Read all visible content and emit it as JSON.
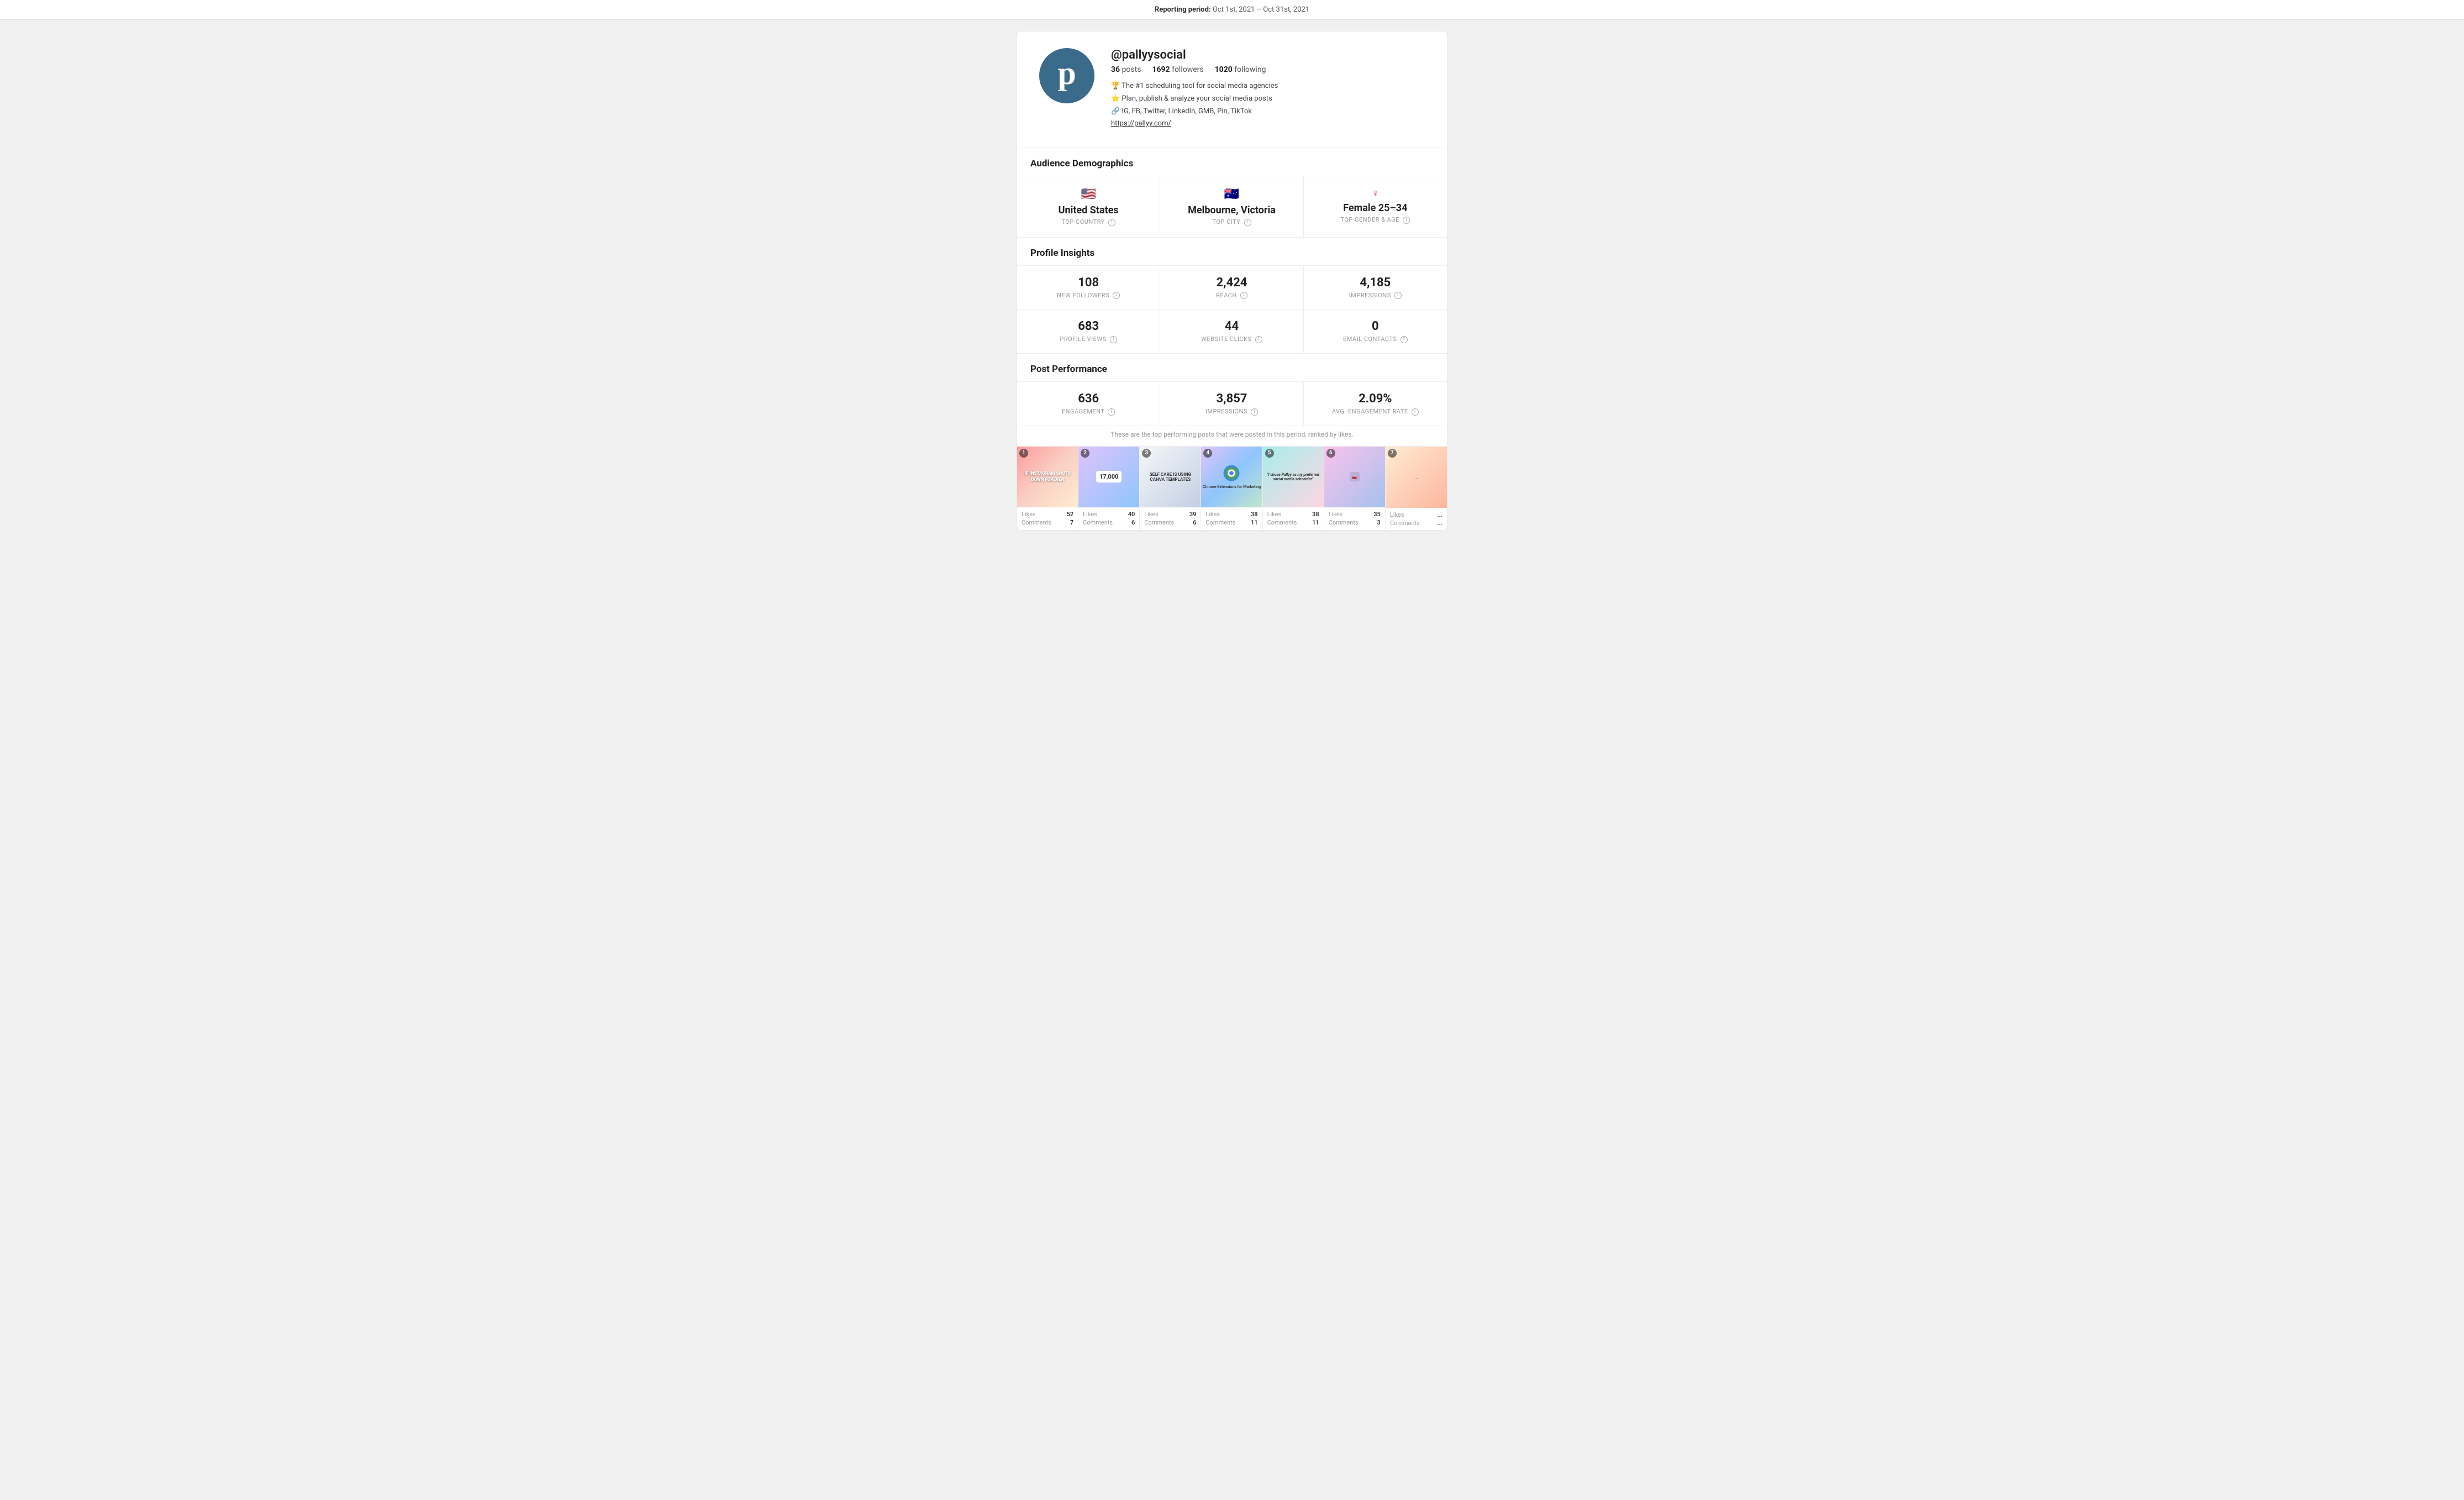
{
  "header": {
    "reporting_label": "Reporting period:",
    "reporting_period": "Oct 1st, 2021 – Oct 31st, 2021"
  },
  "profile": {
    "username": "@pallyysocial",
    "posts_count": "36",
    "posts_label": "posts",
    "followers_count": "1692",
    "followers_label": "followers",
    "following_count": "1020",
    "following_label": "following",
    "bio_line1": "🏆 The #1 scheduling tool for social media agencies",
    "bio_line2": "⭐ Plan, publish & analyze your social media posts",
    "bio_line3": "🔗 IG, FB, Twitter, LinkedIn, GMB, Pin, TikTok",
    "bio_url": "https://pallyy.com/"
  },
  "audience_demographics": {
    "title": "Audience Demographics",
    "top_country": {
      "flag": "🇺🇸",
      "value": "United States",
      "label": "TOP COUNTRY"
    },
    "top_city": {
      "flag": "🇦🇺",
      "value": "Melbourne, Victoria",
      "label": "TOP CITY"
    },
    "top_gender_age": {
      "icon": "♀",
      "value": "Female 25–34",
      "label": "TOP GENDER & AGE"
    }
  },
  "profile_insights": {
    "title": "Profile Insights",
    "metrics": [
      {
        "value": "108",
        "label": "NEW FOLLOWERS"
      },
      {
        "value": "2,424",
        "label": "REACH"
      },
      {
        "value": "4,185",
        "label": "IMPRESSIONS"
      },
      {
        "value": "683",
        "label": "PROFILE VIEWS"
      },
      {
        "value": "44",
        "label": "WEBSITE CLICKS"
      },
      {
        "value": "0",
        "label": "EMAIL CONTACTS"
      }
    ]
  },
  "post_performance": {
    "title": "Post Performance",
    "metrics": [
      {
        "value": "636",
        "label": "ENGAGEMENT"
      },
      {
        "value": "3,857",
        "label": "IMPRESSIONS"
      },
      {
        "value": "2.09%",
        "label": "AVG. ENGAGEMENT RATE"
      }
    ],
    "subtitle": "These are the top performing posts that were posted in this period, ranked by likes."
  },
  "posts": [
    {
      "rank": "1",
      "thumb_class": "thumb-1",
      "text": "IF INSTAGRAM SHUTS DOWN FOREVER",
      "likes": "52",
      "comments": "7"
    },
    {
      "rank": "2",
      "thumb_class": "thumb-2",
      "text": "17,000",
      "likes": "40",
      "comments": "6"
    },
    {
      "rank": "3",
      "thumb_class": "thumb-3",
      "text": "SELF CARE IS USING CANVA TEMPLATES",
      "likes": "39",
      "comments": "6"
    },
    {
      "rank": "4",
      "thumb_class": "thumb-4",
      "text": "Chrome Extensions for Marketing",
      "likes": "38",
      "comments": "11"
    },
    {
      "rank": "5",
      "thumb_class": "thumb-5",
      "text": "\"I chose Pallyy as my preferred social media scheduler\"",
      "likes": "38",
      "comments": "11"
    },
    {
      "rank": "6",
      "thumb_class": "thumb-6",
      "text": "",
      "likes": "35",
      "comments": "3"
    },
    {
      "rank": "7",
      "thumb_class": "thumb-7",
      "text": "",
      "likes": "...",
      "comments": "..."
    }
  ],
  "labels": {
    "likes": "Likes",
    "comments": "Comments"
  }
}
